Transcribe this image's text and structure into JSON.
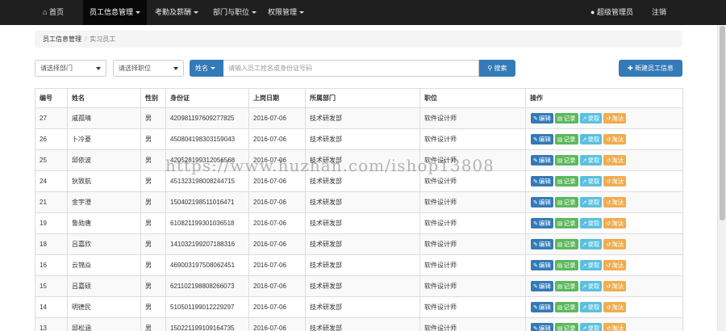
{
  "navbar": {
    "brand": "首页",
    "menus": [
      "员工信息管理",
      "考勤及薪酬",
      "部门与职位",
      "权限管理"
    ],
    "user": "超级管理员",
    "logout": "注销"
  },
  "breadcrumb": {
    "root": "员工信息管理",
    "current": "实习员工"
  },
  "filters": {
    "department_placeholder": "请选择部门",
    "position_placeholder": "请选择职位",
    "search_type": "姓名",
    "search_placeholder": "请输入员工姓名或身份证号码",
    "search_button": "搜索",
    "new_button": "新建员工信息"
  },
  "table": {
    "headers": [
      "编号",
      "姓名",
      "性别",
      "身份证",
      "上岗日期",
      "所属部门",
      "职位",
      "操作"
    ],
    "action_labels": [
      "编辑",
      "记录",
      "录取",
      "淘汰"
    ],
    "rows": [
      [
        "27",
        "戚孤晴",
        "男",
        "420981197609277825",
        "2016-07-06",
        "技术研发部",
        "软件设计师"
      ],
      [
        "26",
        "卜冷菱",
        "男",
        "450804198303159043",
        "2016-07-06",
        "技术研发部",
        "软件设计师"
      ],
      [
        "25",
        "邱依波",
        "男",
        "420528199312056568",
        "2016-07-06",
        "技术研发部",
        "软件设计师"
      ],
      [
        "24",
        "狄致航",
        "男",
        "451323198008244715",
        "2016-07-06",
        "技术研发部",
        "软件设计师"
      ],
      [
        "21",
        "金宇澄",
        "男",
        "150402198511016471",
        "2016-07-06",
        "技术研发部",
        "软件设计师"
      ],
      [
        "19",
        "鲁勋唐",
        "男",
        "610821199301036518",
        "2016-07-06",
        "技术研发部",
        "软件设计师"
      ],
      [
        "18",
        "吕嘉欣",
        "男",
        "141032199207188316",
        "2016-07-06",
        "技术研发部",
        "软件设计师"
      ],
      [
        "16",
        "云锦焱",
        "男",
        "469003197508062451",
        "2016-07-06",
        "技术研发部",
        "软件设计师"
      ],
      [
        "15",
        "吕嘉硕",
        "男",
        "621102198808266073",
        "2016-07-06",
        "技术研发部",
        "软件设计师"
      ],
      [
        "14",
        "明德民",
        "男",
        "510501199012229297",
        "2016-07-06",
        "技术研发部",
        "软件设计师"
      ],
      [
        "13",
        "邱松涵",
        "男",
        "150221199109164735",
        "2016-07-06",
        "技术研发部",
        "软件设计师"
      ]
    ]
  },
  "watermark": "https://www.huzhan.com/ishop13808",
  "colors": {
    "primary": "#337ab7",
    "success": "#5cb85c",
    "info": "#5bc0de",
    "warning": "#f0ad4e",
    "navbar": "#1f1f1f"
  }
}
